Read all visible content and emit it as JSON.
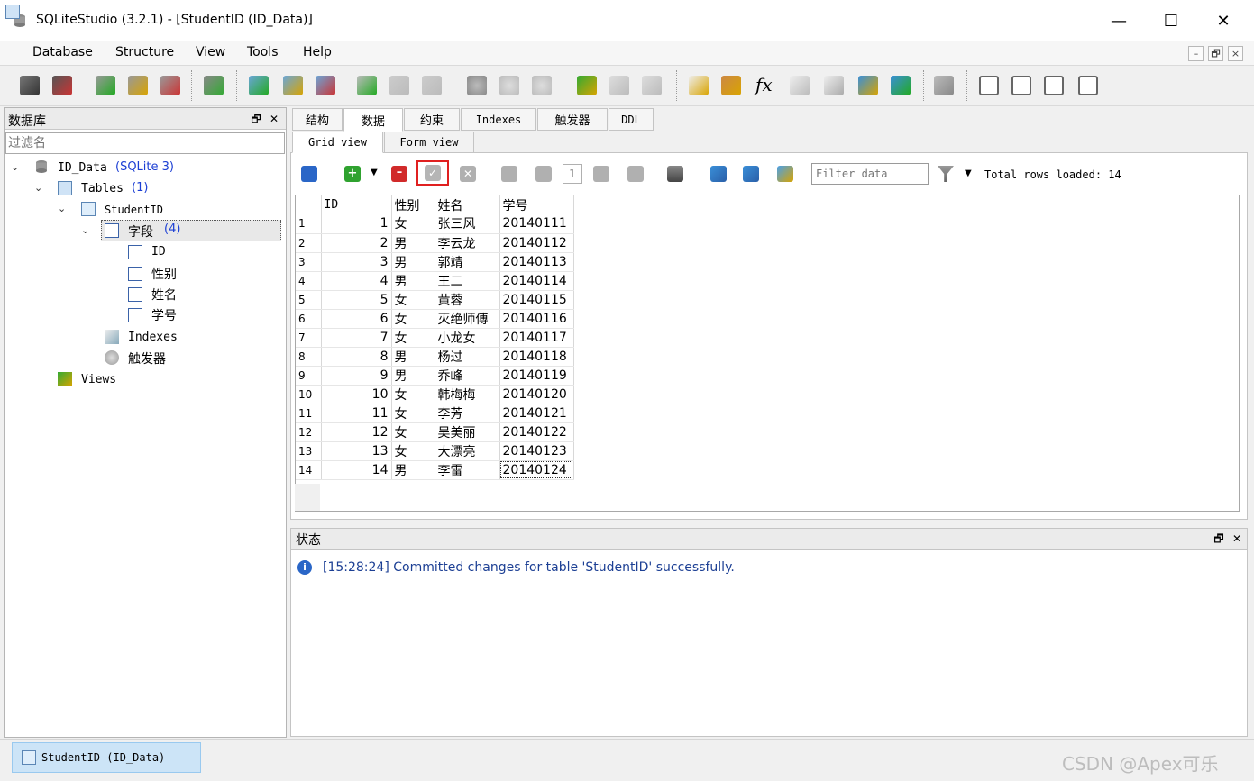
{
  "window": {
    "title": "SQLiteStudio (3.2.1) - [StudentID (ID_Data)]",
    "minimize_glyph": "—",
    "maximize_glyph": "☐",
    "close_glyph": "✕"
  },
  "menu": {
    "items": [
      "Database",
      "Structure",
      "View",
      "Tools",
      "Help"
    ],
    "mdi_min": "–",
    "mdi_restore": "🗗",
    "mdi_close": "×"
  },
  "left_dock": {
    "title": "数据库",
    "float_glyph": "🗗",
    "close_glyph": "✕",
    "filter_placeholder": "过滤名",
    "tree": {
      "db_name": "ID_Data",
      "db_type": "(SQLite 3)",
      "tables_label": "Tables",
      "tables_count": "(1)",
      "table_name": "StudentID",
      "columns_label": "字段",
      "columns_count": "(4)",
      "columns": [
        "ID",
        "性别",
        "姓名",
        "学号"
      ],
      "indexes_label": "Indexes",
      "triggers_label": "触发器",
      "views_label": "Views"
    }
  },
  "tabs": [
    "结构",
    "数据",
    "约束",
    "Indexes",
    "触发器",
    "DDL"
  ],
  "active_tab": "数据",
  "subtabs": [
    "Grid view",
    "Form view"
  ],
  "data_toolbar": {
    "page_number": "1",
    "filter_placeholder": "Filter data",
    "total_rows": "Total rows loaded: 14"
  },
  "grid": {
    "columns": [
      "ID",
      "性别",
      "姓名",
      "学号"
    ],
    "rows": [
      {
        "n": "1",
        "id": "1",
        "sex": "女",
        "name": "张三风",
        "no": "20140111"
      },
      {
        "n": "2",
        "id": "2",
        "sex": "男",
        "name": "李云龙",
        "no": "20140112"
      },
      {
        "n": "3",
        "id": "3",
        "sex": "男",
        "name": "郭靖",
        "no": "20140113"
      },
      {
        "n": "4",
        "id": "4",
        "sex": "男",
        "name": "王二",
        "no": "20140114"
      },
      {
        "n": "5",
        "id": "5",
        "sex": "女",
        "name": "黄蓉",
        "no": "20140115"
      },
      {
        "n": "6",
        "id": "6",
        "sex": "女",
        "name": "灭绝师傅",
        "no": "20140116"
      },
      {
        "n": "7",
        "id": "7",
        "sex": "女",
        "name": "小龙女",
        "no": "20140117"
      },
      {
        "n": "8",
        "id": "8",
        "sex": "男",
        "name": "杨过",
        "no": "20140118"
      },
      {
        "n": "9",
        "id": "9",
        "sex": "男",
        "name": "乔峰",
        "no": "20140119"
      },
      {
        "n": "10",
        "id": "10",
        "sex": "女",
        "name": "韩梅梅",
        "no": "20140120"
      },
      {
        "n": "11",
        "id": "11",
        "sex": "女",
        "name": "李芳",
        "no": "20140121"
      },
      {
        "n": "12",
        "id": "12",
        "sex": "女",
        "name": "吴美丽",
        "no": "20140122"
      },
      {
        "n": "13",
        "id": "13",
        "sex": "女",
        "name": "大漂亮",
        "no": "20140123"
      },
      {
        "n": "14",
        "id": "14",
        "sex": "男",
        "name": "李雷",
        "no": "20140124"
      }
    ]
  },
  "status_panel": {
    "title": "状态",
    "float_glyph": "🗗",
    "close_glyph": "✕",
    "message": "[15:28:24] Committed changes for table 'StudentID' successfully."
  },
  "taskbar": {
    "item_label": "StudentID (ID_Data)"
  },
  "watermark": "CSDN @Apex可乐",
  "colors": {
    "accent_blue": "#1c3f94",
    "highlight_red": "#e02020",
    "selection": "#cce4f7"
  }
}
